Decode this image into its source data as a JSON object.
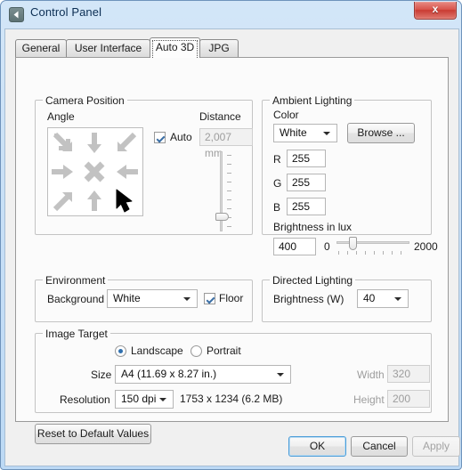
{
  "window": {
    "title": "Control Panel",
    "app_icon": "back-chevron-icon",
    "close_label": "x"
  },
  "tabs": [
    {
      "label": "General",
      "active": false
    },
    {
      "label": "User Interface",
      "active": false
    },
    {
      "label": "Auto 3D",
      "active": true
    },
    {
      "label": "JPG",
      "active": false
    }
  ],
  "camera_position": {
    "title": "Camera Position",
    "angle_label": "Angle",
    "angle_cells": [
      "arrow-down-right-icon",
      "arrow-down-icon",
      "arrow-down-left-icon",
      "arrow-right-icon",
      "cross-icon",
      "arrow-left-icon",
      "arrow-up-right-icon",
      "arrow-up-icon",
      "arrow-up-left-cursor-icon"
    ],
    "auto_label": "Auto",
    "auto_checked": true,
    "distance_label": "Distance",
    "distance_value": "2,007 mm",
    "distance_disabled": true
  },
  "ambient_lighting": {
    "title": "Ambient Lighting",
    "color_label": "Color",
    "color_value": "White",
    "browse_label": "Browse ...",
    "r_label": "R",
    "r_value": "255",
    "g_label": "G",
    "g_value": "255",
    "b_label": "B",
    "b_value": "255",
    "brightness_label": "Brightness in lux",
    "brightness_value": "400",
    "brightness_min": "0",
    "brightness_max": "2000",
    "brightness_percent": 20
  },
  "environment": {
    "title": "Environment",
    "background_label": "Background",
    "background_value": "White",
    "floor_label": "Floor",
    "floor_checked": true
  },
  "directed_lighting": {
    "title": "Directed Lighting",
    "brightness_label": "Brightness (W)",
    "brightness_value": "40"
  },
  "image_target": {
    "title": "Image Target",
    "landscape_label": "Landscape",
    "portrait_label": "Portrait",
    "orientation": "Landscape",
    "size_label": "Size",
    "size_value": "A4 (11.69 x 8.27 in.)",
    "resolution_label": "Resolution",
    "resolution_value": "150 dpi",
    "pixel_info": "1753 x 1234 (6.2 MB)",
    "width_label": "Width",
    "width_value": "320",
    "height_label": "Height",
    "height_value": "200",
    "dimensions_disabled": true
  },
  "footer": {
    "reset_label": "Reset to Default Values",
    "ok_label": "OK",
    "cancel_label": "Cancel",
    "apply_label": "Apply",
    "apply_disabled": true
  },
  "colors": {
    "accent": "#4c9ed9",
    "frame": "#bcd9f5",
    "dialog": "#f0f0f0",
    "close_red": "#c93c33"
  }
}
